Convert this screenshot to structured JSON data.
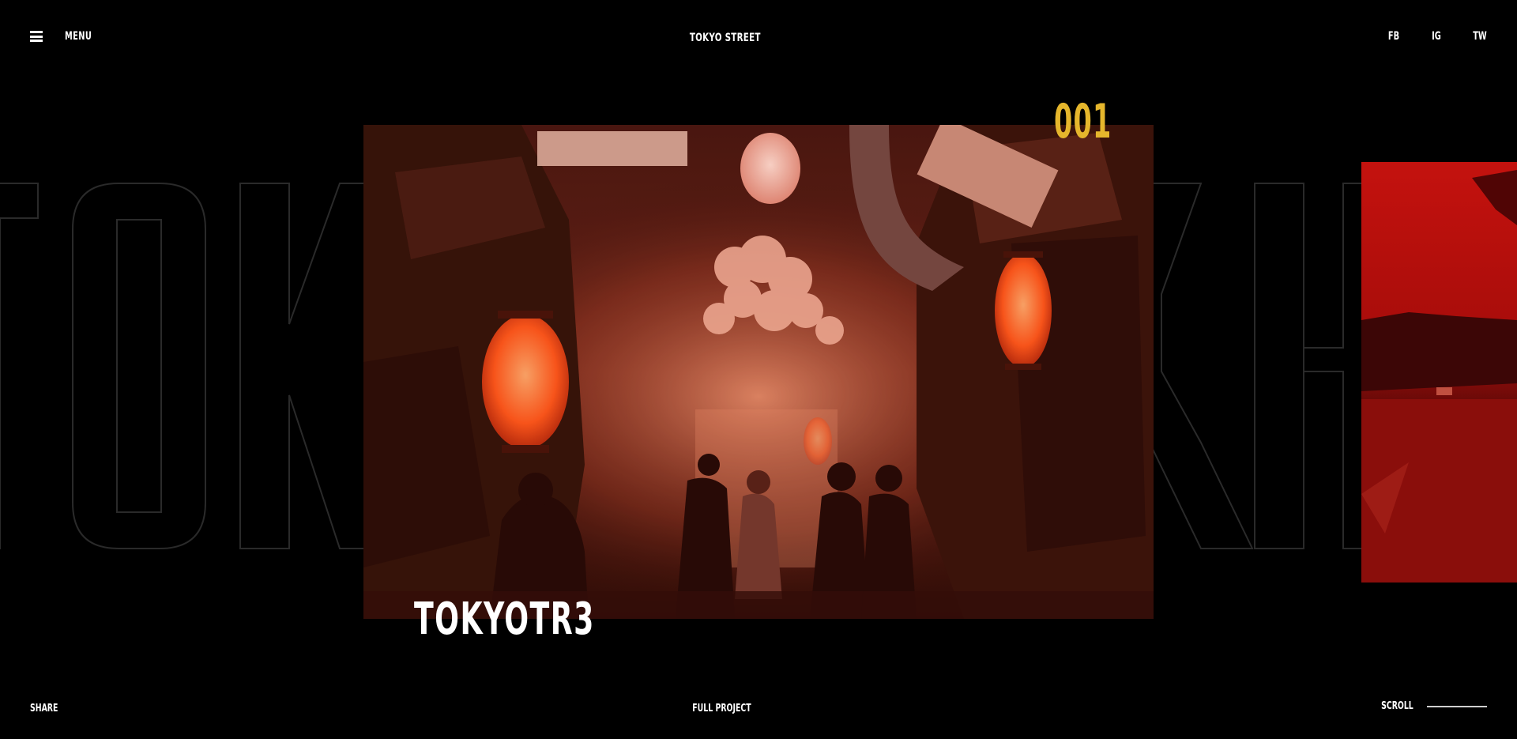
{
  "header": {
    "menu_label": "MENU",
    "site_title": "TOKYO STREET",
    "social": [
      {
        "label": "FB"
      },
      {
        "label": "IG"
      },
      {
        "label": "TW"
      }
    ]
  },
  "background_word": "TOKYO",
  "slide": {
    "index": "001",
    "title": "TOKYOTR3"
  },
  "footer": {
    "share_label": "SHARE",
    "full_project_label": "FULL PROJECT",
    "scroll_label": "SCROLL"
  },
  "colors": {
    "background": "#000000",
    "accent": "#e5b62c",
    "text": "#ffffff"
  }
}
